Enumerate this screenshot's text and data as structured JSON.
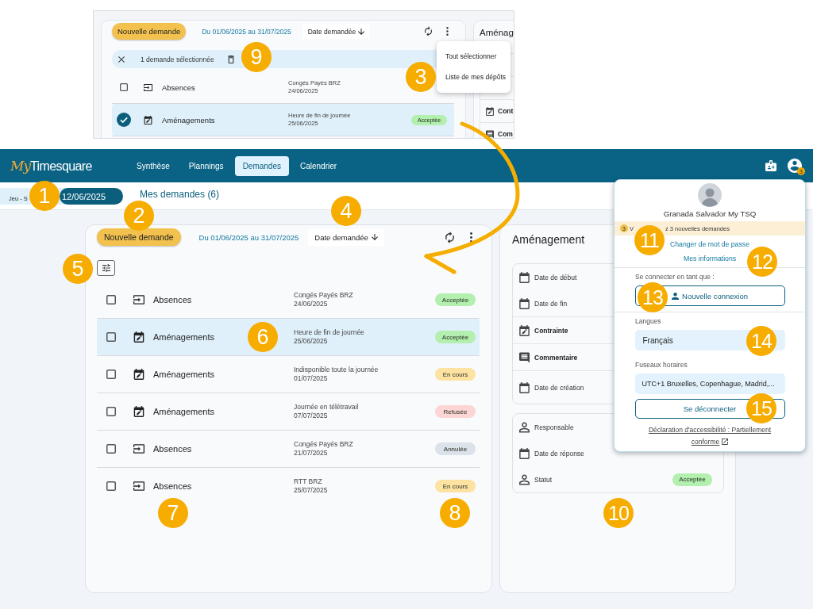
{
  "inset": {
    "toolbar": {
      "new_request": "Nouvelle demande",
      "period": "Du 01/06/2025 au 31/07/2025",
      "sort": "Date demandée"
    },
    "selection_bar": {
      "text": "1 demande sélectionnée"
    },
    "rows": [
      {
        "kind": "absence",
        "category": "Absences",
        "detail": "Congés Payés BRZ",
        "date": "24/06/2025",
        "checked": false,
        "selected": false
      },
      {
        "kind": "adjustment",
        "category": "Aménagements",
        "detail": "Heure de fin de journée",
        "date": "25/06/2025",
        "checked": true,
        "selected": true,
        "status": {
          "label": "Acceptée",
          "color": "#b3efae"
        }
      }
    ],
    "menu": [
      "Tout sélectionner",
      "Liste de mes dépôts"
    ],
    "detail": {
      "title": "Aménag",
      "rows": [
        {
          "kind": "calendar-edit",
          "label": "Cont"
        },
        {
          "kind": "comment",
          "label": "Com"
        }
      ]
    }
  },
  "header": {
    "logo_script": "My",
    "logo_name": "Timesquare",
    "nav": [
      {
        "label": "Synthèse",
        "selected": false
      },
      {
        "label": "Plannings",
        "selected": false
      },
      {
        "label": "Demandes",
        "selected": true
      },
      {
        "label": "Calendrier",
        "selected": false
      }
    ],
    "notification_count": "3"
  },
  "date_bar": {
    "day": "Jeu - S",
    "date": "12/06/2025"
  },
  "page_title": "Mes demandes (6)",
  "requests": {
    "toolbar": {
      "new_request": "Nouvelle demande",
      "period": "Du 01/06/2025 au 31/07/2025",
      "sort": "Date demandée"
    },
    "rows": [
      {
        "kind": "absence",
        "category": "Absences",
        "detail": "Congés Payés BRZ",
        "date": "24/06/2025",
        "checked": false,
        "selected": false,
        "status": {
          "label": "Acceptée",
          "color": "#b3efae"
        }
      },
      {
        "kind": "adjustment",
        "category": "Aménagements",
        "detail": "Heure de fin de journée",
        "date": "25/06/2025",
        "checked": false,
        "selected": true,
        "status": {
          "label": "Acceptée",
          "color": "#b3efae"
        }
      },
      {
        "kind": "adjustment",
        "category": "Aménagements",
        "detail": "Indisponible toute la journée",
        "date": "01/07/2025",
        "checked": false,
        "selected": false,
        "status": {
          "label": "En cours",
          "color": "#fde2a2"
        }
      },
      {
        "kind": "adjustment",
        "category": "Aménagements",
        "detail": "Journée en télétravail",
        "date": "07/07/2025",
        "checked": false,
        "selected": false,
        "status": {
          "label": "Refusée",
          "color": "#fdd5d5"
        }
      },
      {
        "kind": "absence",
        "category": "Absences",
        "detail": "Congés Payés BRZ",
        "date": "21/07/2025",
        "checked": false,
        "selected": false,
        "status": {
          "label": "Annulée",
          "color": "#dce2e9"
        }
      },
      {
        "kind": "absence",
        "category": "Absences",
        "detail": "RTT BRZ",
        "date": "25/07/2025",
        "checked": false,
        "selected": false,
        "status": {
          "label": "En cours",
          "color": "#fde2a2"
        }
      }
    ]
  },
  "detail": {
    "title": "Aménagement",
    "cards": [
      {
        "groups": [
          {
            "rows": [
              {
                "kind": "calendar",
                "label": "Date de début",
                "emphasized": false
              },
              {
                "kind": "calendar",
                "label": "Date de fin",
                "emphasized": false
              }
            ]
          },
          {
            "rows": [
              {
                "kind": "calendar-edit",
                "label": "Contrainte",
                "emphasized": true
              }
            ]
          },
          {
            "rows": [
              {
                "kind": "comment",
                "label": "Commentaire",
                "emphasized": true
              }
            ]
          },
          {
            "rows": [
              {
                "kind": "calendar",
                "label": "Date de création",
                "emphasized": false
              }
            ]
          }
        ]
      },
      {
        "groups": [
          {
            "rows": [
              {
                "kind": "person",
                "label": "Responsable",
                "emphasized": false
              },
              {
                "kind": "calendar",
                "label": "Date de réponse",
                "emphasized": false
              },
              {
                "kind": "person",
                "label": "Statut",
                "emphasized": false,
                "status": {
                  "label": "Acceptée",
                  "color": "#b3efae"
                }
              }
            ]
          }
        ]
      }
    ]
  },
  "user_menu": {
    "name": "Granada Salvador My TSQ",
    "notice": {
      "count": "3",
      "text_parts": [
        "V",
        "z 3 nouvelles demandes"
      ]
    },
    "links": [
      "Changer de mot de passe",
      "Mes informations"
    ],
    "switch_label": "Se connecter en tant que :",
    "switch_button": "Nouvelle connexion",
    "language_label": "Langues",
    "language": "Français",
    "timezone_label": "Fuseaux horaires",
    "timezone": "UTC+1 Bruxelles, Copenhague, Madrid,...",
    "logout": "Se déconnecter",
    "accessibility": "Déclaration d'accessibilité : Partiellement conforme"
  },
  "callouts": [
    "1",
    "2",
    "3",
    "4",
    "5",
    "6",
    "7",
    "8",
    "9",
    "10",
    "11",
    "12",
    "13",
    "14",
    "15"
  ]
}
